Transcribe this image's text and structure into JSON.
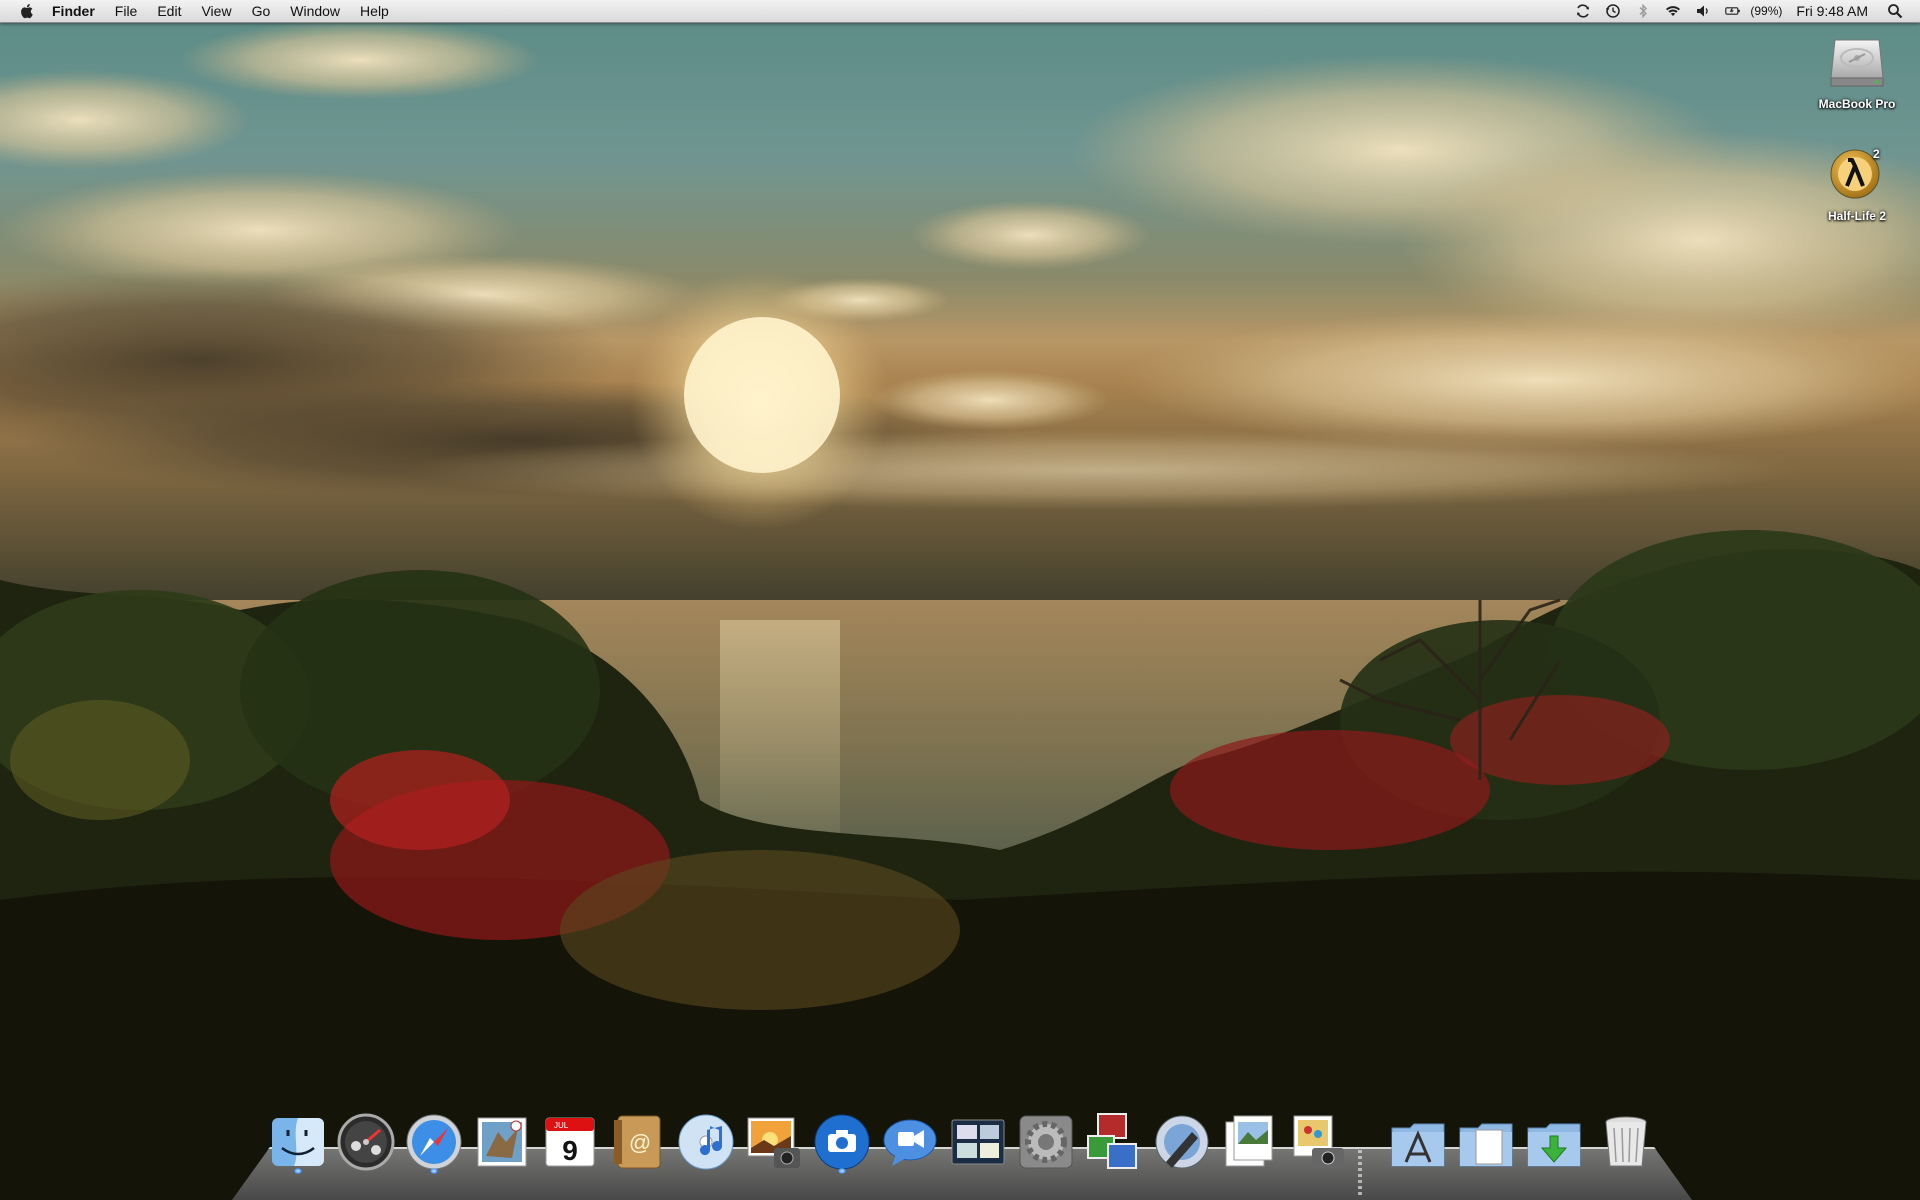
{
  "menubar": {
    "app_name": "Finder",
    "menus": [
      "File",
      "Edit",
      "View",
      "Go",
      "Window",
      "Help"
    ],
    "battery_percent": "(99%)",
    "clock": "Fri 9:48 AM",
    "status_icons": [
      "sync-icon",
      "time-machine-icon",
      "bluetooth-icon",
      "wifi-icon",
      "volume-icon",
      "battery-icon",
      "spotlight-icon"
    ]
  },
  "desktop": {
    "icons": [
      {
        "label": "MacBook Pro",
        "icon": "hard-drive-icon"
      },
      {
        "label": "Half-Life 2",
        "icon": "half-life-2-icon"
      }
    ]
  },
  "dock": {
    "items": [
      "finder",
      "dashboard",
      "safari",
      "mail",
      "ical",
      "address-book",
      "itunes",
      "iphoto",
      "image-capture",
      "ichat",
      "expose",
      "system-preferences",
      "spaces",
      "directory-utility",
      "preview",
      "image-capture-2",
      "applications-stack",
      "documents-stack",
      "downloads-stack",
      "trash"
    ],
    "calendar_month": "JUL",
    "calendar_day": "9"
  },
  "colors": {
    "menubar_top": "#f2f2f2",
    "menubar_bottom": "#d9d9d9",
    "sky_teal": "#4f8a85",
    "sun": "#fff6d0",
    "foliage_dark": "#1a1a0c",
    "foliage_red": "#b01818"
  }
}
